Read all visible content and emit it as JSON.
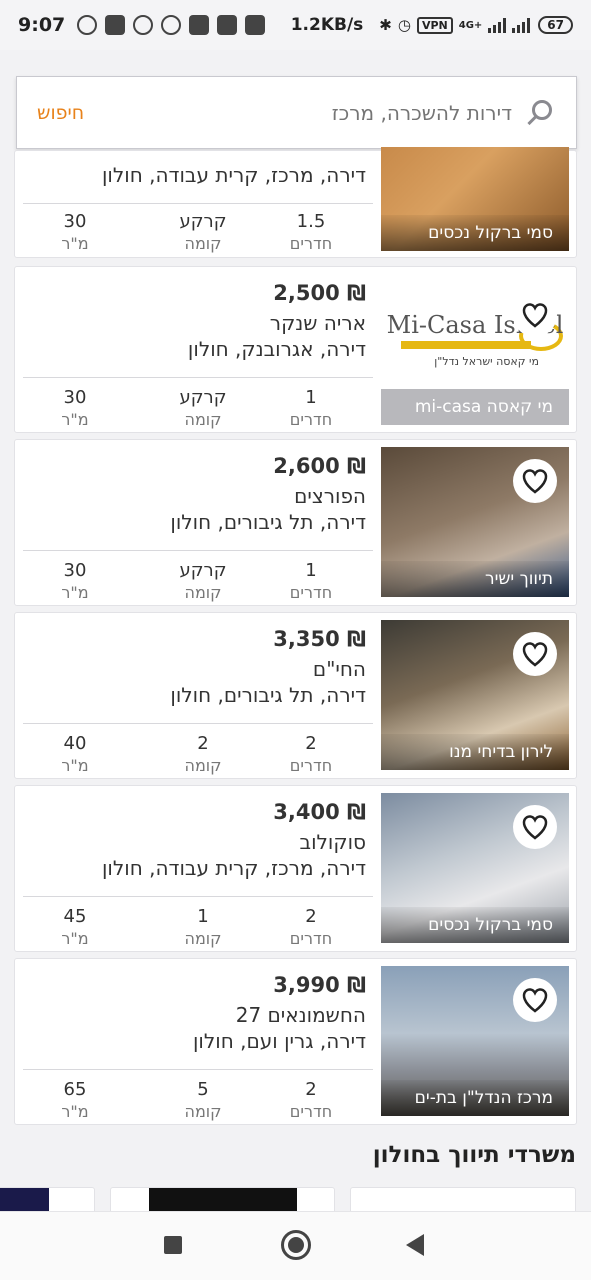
{
  "status_bar": {
    "time": "9:07",
    "speed": "1.2KB/s",
    "vpn": "VPN",
    "network": "4G+",
    "battery": "67"
  },
  "search": {
    "placeholder": "דירות להשכרה, מרכז",
    "button_label": "חיפוש"
  },
  "listings": [
    {
      "price": "",
      "street": "",
      "address": "דירה, מרכז, קרית עבודה, חולון",
      "rooms": "1.5",
      "floor": "קרקע",
      "area": "30",
      "agency": "סמי ברקול נכסים",
      "favorite": false
    },
    {
      "price": "₪ 2,500",
      "street": "אריה שנקר",
      "address": "דירה, אגרובנק, חולון",
      "rooms": "1",
      "floor": "קרקע",
      "area": "30",
      "agency": "מי קאסה mi-casa",
      "logo_text": "Mi-Casa Israel",
      "logo_sub": "מי קאסה ישראל נדל\"ן",
      "favorite": false
    },
    {
      "price": "₪ 2,600",
      "street": "הפורצים",
      "address": "דירה, תל גיבורים, חולון",
      "rooms": "1",
      "floor": "קרקע",
      "area": "30",
      "agency": "תיווך ישיר",
      "favorite": false
    },
    {
      "price": "₪ 3,350",
      "street": "החי\"ם",
      "address": "דירה, תל גיבורים, חולון",
      "rooms": "2",
      "floor": "2",
      "area": "40",
      "agency": "לירון בדיחי מנו",
      "favorite": false
    },
    {
      "price": "₪ 3,400",
      "street": "סוקולוב",
      "address": "דירה, מרכז, קרית עבודה, חולון",
      "rooms": "2",
      "floor": "1",
      "area": "45",
      "agency": "סמי ברקול נכסים",
      "favorite": false
    },
    {
      "price": "₪ 3,990",
      "street": "החשמונאים 27",
      "address": "דירה, גרין ועם, חולון",
      "rooms": "2",
      "floor": "5",
      "area": "65",
      "agency": "מרכז הנדל\"ן בת-ים",
      "favorite": false
    }
  ],
  "labels": {
    "rooms": "חדרים",
    "floor": "קומה",
    "area": "מ\"ר"
  },
  "section_title": "משרדי תיווך בחולון"
}
